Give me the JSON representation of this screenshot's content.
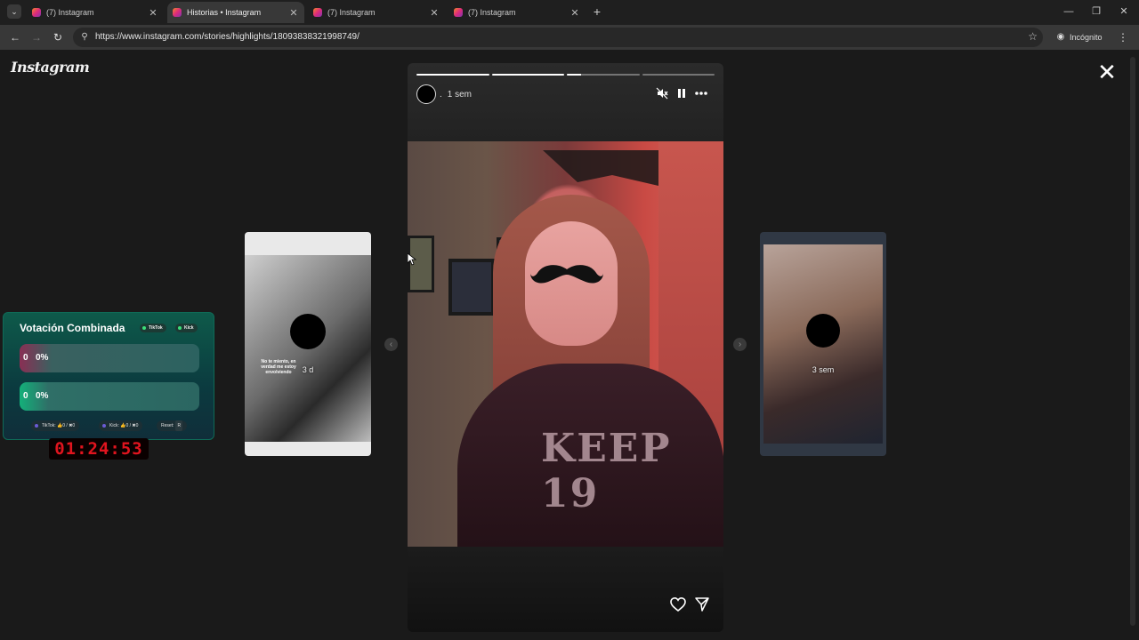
{
  "browser": {
    "tabs": [
      {
        "title": "(7) Instagram",
        "active": false
      },
      {
        "title": "Historias • Instagram",
        "active": true
      },
      {
        "title": "(7) Instagram",
        "active": false
      },
      {
        "title": "(7) Instagram",
        "active": false
      }
    ],
    "url": "https://www.instagram.com/stories/highlights/18093838321998749/",
    "incognito_label": "Incógnito",
    "icons": {
      "tab_list": "chevron-down-icon",
      "back": "back-arrow-icon",
      "forward": "forward-arrow-icon",
      "reload": "reload-icon",
      "site_info": "tune-icon",
      "bookmark": "star-icon",
      "incognito": "incognito-icon",
      "menu": "more-vert-icon"
    },
    "glyphs": {
      "tab_list": "⌄",
      "tab_close": "✕",
      "new_tab": "+",
      "minimize": "—",
      "restore": "❐",
      "close": "✕",
      "back": "←",
      "forward": "→",
      "reload": "↻",
      "site_info": "⚲",
      "star": "☆",
      "incognito": "◉",
      "menu": "⋮"
    }
  },
  "page": {
    "logo_text": "Instagram",
    "close_glyph": "✕",
    "story": {
      "age": "1 sem",
      "separator": ".",
      "progress_fill": [
        1,
        1,
        0.2,
        0
      ],
      "controls": {
        "mute": "mute-icon",
        "pause": "pause-icon",
        "more": "more-horiz-icon"
      },
      "shirt_text": "KEEP 19",
      "footer": {
        "like": "heart-icon",
        "share": "send-icon"
      }
    },
    "side_left": {
      "age": "3 d",
      "caption": "No te miento, en verdad me estoy envolviendo"
    },
    "side_right": {
      "age": "3 sem"
    },
    "arrow_glyph": "‹",
    "arrow_next_glyph": "›"
  },
  "vote": {
    "title": "Votación Combinada",
    "platforms": [
      "TikTok",
      "Kick"
    ],
    "options": [
      {
        "count": "0",
        "percent": "0%",
        "color": "#8a2f54"
      },
      {
        "count": "0",
        "percent": "0%",
        "color": "#14b07a"
      }
    ],
    "stats": {
      "tiktok": "TikTok: 👍0 / ✖0",
      "kick": "Kick: 👍0 / ✖0",
      "reset_label": "Reset:",
      "reset_key": "R"
    },
    "timer": "01:24:53"
  }
}
